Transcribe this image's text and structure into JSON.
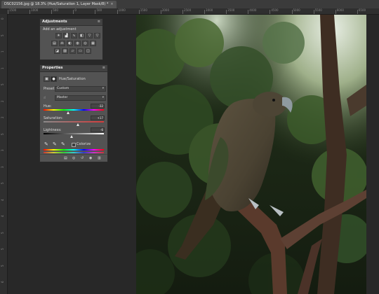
{
  "document_tab": {
    "title": "DSC02156.jpg @ 18.3% (Hue/Saturation 1, Layer Mask/8) *",
    "close_glyph": "×"
  },
  "ruler": {
    "top_labels": [
      "1500",
      "1000",
      "500",
      "0",
      "500",
      "1000",
      "1500",
      "2000",
      "2500",
      "3000",
      "3500",
      "4000",
      "4500",
      "5000",
      "5500",
      "6000",
      "6500"
    ],
    "left_labels": [
      "0",
      "5",
      "1",
      "1",
      "5",
      "2",
      "2",
      "5",
      "3",
      "3",
      "5",
      "4",
      "4",
      "5",
      "5",
      "5",
      "6"
    ]
  },
  "adjustments_panel": {
    "title": "Adjustments",
    "subtitle": "Add an adjustment",
    "menu_glyph": "≡",
    "row1": [
      "brightness-contrast-icon",
      "levels-icon",
      "curves-icon",
      "exposure-icon",
      "vibrance-icon",
      "triangle-icon"
    ],
    "row2": [
      "hue-saturation-icon",
      "color-balance-icon",
      "black-white-icon",
      "photo-filter-icon",
      "channel-mixer-icon",
      "color-lookup-icon"
    ],
    "row3": [
      "invert-icon",
      "posterize-icon",
      "threshold-icon",
      "gradient-map-icon",
      "selective-color-icon"
    ]
  },
  "properties_panel": {
    "title": "Properties",
    "menu_glyph": "≡",
    "close_glyph": "×",
    "layer_type": "Hue/Saturation",
    "preset_label": "Preset:",
    "preset_value": "Custom",
    "channel_value": "Master",
    "hue_label": "Hue:",
    "hue_value": "-32",
    "hue_level": 0.41,
    "saturation_label": "Saturation:",
    "saturation_value": "+17",
    "saturation_level": 0.58,
    "lightness_label": "Lightness:",
    "lightness_value": "-6",
    "lightness_level": 0.47,
    "colorize_label": "Colorize",
    "footer_icons": [
      "clip-to-layer-icon",
      "view-previous-icon",
      "reset-icon",
      "visibility-icon",
      "delete-icon"
    ]
  },
  "colors": {
    "workspace": "#282828",
    "panel": "#535353",
    "panel_header": "#424242"
  }
}
